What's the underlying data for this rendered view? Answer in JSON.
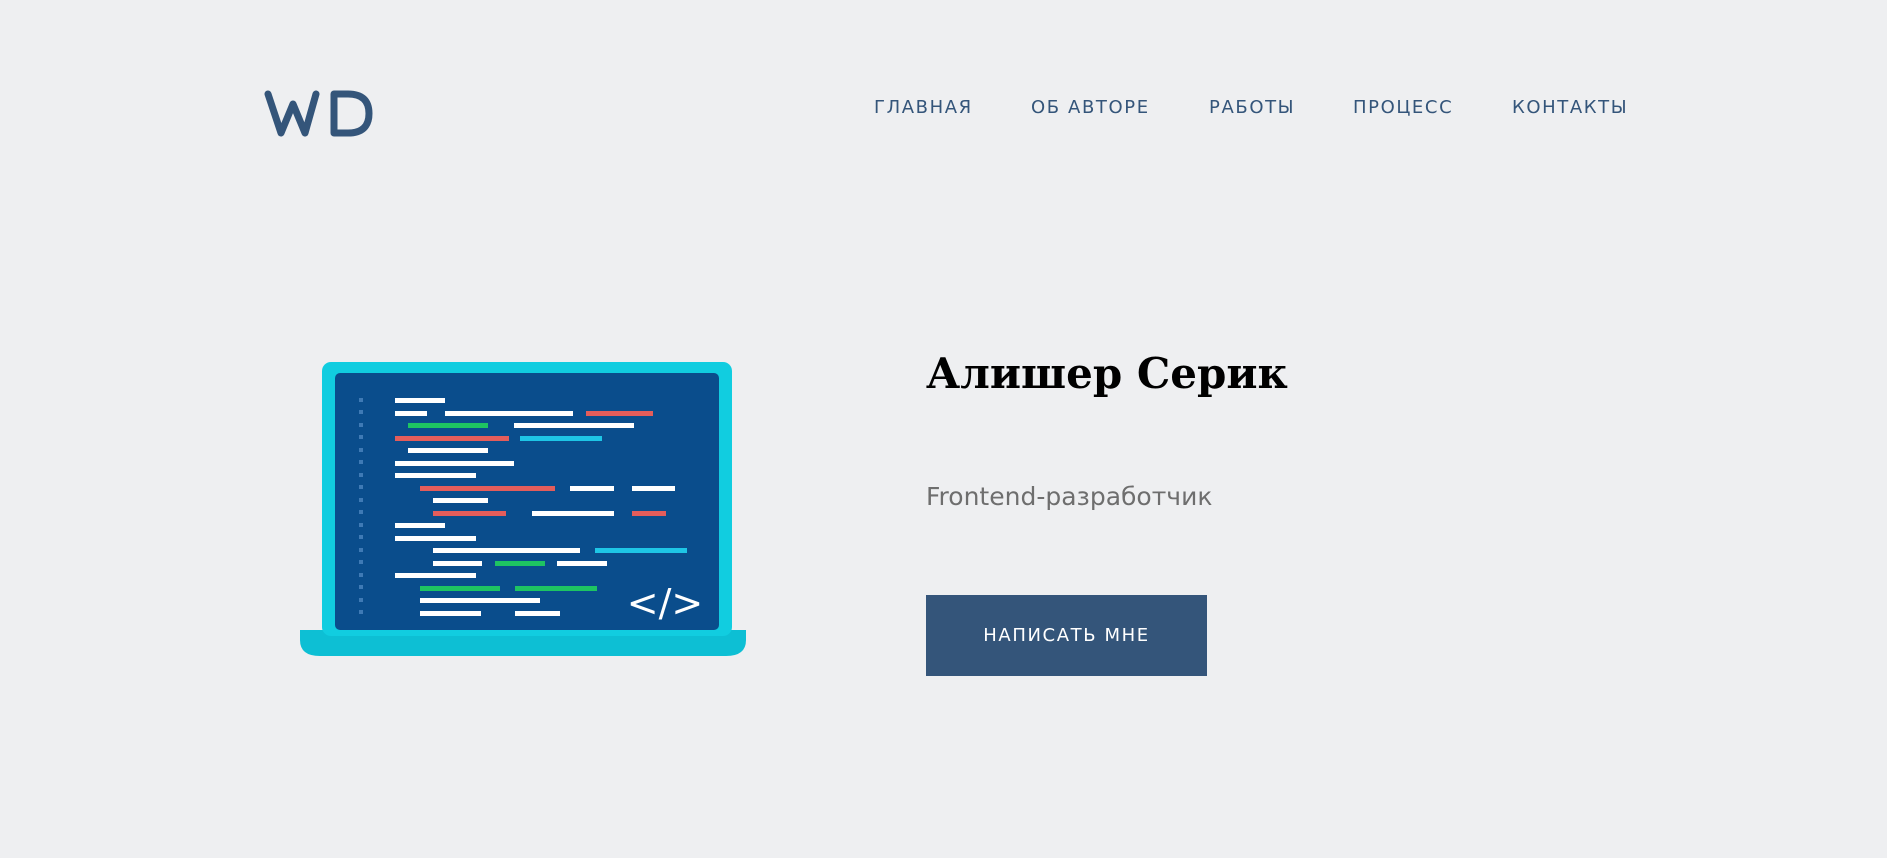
{
  "header": {
    "logo_text": "WD",
    "nav": [
      {
        "label": "ГЛАВНАЯ"
      },
      {
        "label": "ОБ АВТОРЕ"
      },
      {
        "label": "РАБОТЫ"
      },
      {
        "label": "ПРОЦЕСС"
      },
      {
        "label": "КОНТАКТЫ"
      }
    ]
  },
  "hero": {
    "name": "Алишер Серик",
    "role": "Frontend-разработчик",
    "cta_label": "НАПИСАТЬ МНЕ",
    "illustration_code_glyph": "</>"
  },
  "colors": {
    "background": "#eeeff1",
    "accent": "#34557a",
    "screen": "#0a4d8c",
    "laptop_frame": "#11cde0",
    "code_white": "#ffffff",
    "code_red": "#e35d5b",
    "code_green": "#1ec462",
    "code_cyan": "#1ec6e6"
  }
}
